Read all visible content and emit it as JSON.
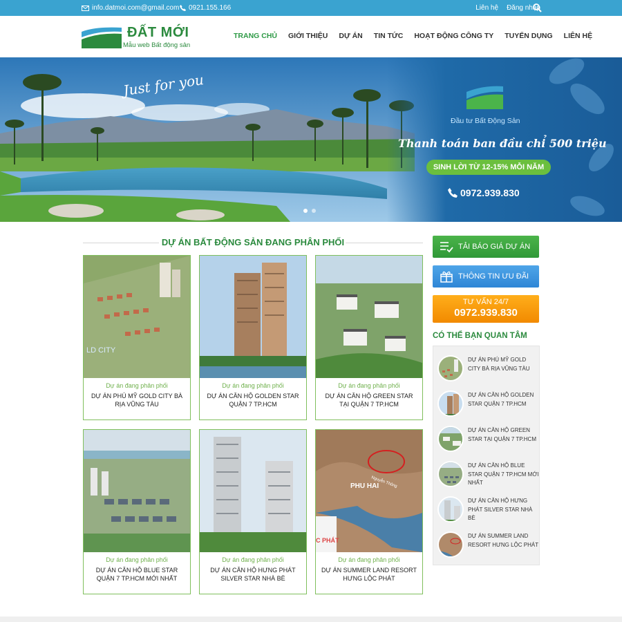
{
  "topbar": {
    "email": "info.datmoi.com@gmail.com",
    "phone": "0921.155.166",
    "links": [
      "Liên hệ",
      "Đăng nhập"
    ]
  },
  "logo": {
    "title": "ĐẤT MỚI",
    "subtitle": "Mẫu web Bất động sản"
  },
  "nav": [
    "TRANG CHỦ",
    "GIỚI THIỆU",
    "DỰ ÁN",
    "TIN TỨC",
    "HOẠT ĐỘNG CÔNG TY",
    "TUYỂN DỤNG",
    "LIÊN HỆ"
  ],
  "banner": {
    "script_text": "Just for you",
    "brand": "Đầu tư Bất Động Sản",
    "headline": "Thanh toán ban đầu chỉ 500 triệu",
    "pill": "SINH LỜI TỪ 12-15% MỖI NĂM",
    "phone": "0972.939.830",
    "thumb_caption": "LD CITY"
  },
  "section": {
    "title": "DỰ ÁN BẤT ĐỘNG SẢN ĐANG PHÂN PHỐI"
  },
  "projects": [
    {
      "category": "Dự án đang phân phối",
      "name": "DỰ ÁN PHÚ MỸ GOLD CITY BÀ RỊA VŨNG TÀU"
    },
    {
      "category": "Dự án đang phân phối",
      "name": "DỰ ÁN CĂN HỘ GOLDEN STAR QUẬN 7 Tp.HCM"
    },
    {
      "category": "Dự án đang phân phối",
      "name": "DỰ ÁN CĂN HỘ GREEN STAR TẠI QUẬN 7 TP.HCM"
    },
    {
      "category": "Dự án đang phân phối",
      "name": "DỰ ÁN CĂN HỘ BLUE STAR QUẬN 7 TP.HCM MỚI NHẤT"
    },
    {
      "category": "Dự án đang phân phối",
      "name": "DỰ ÁN CĂN HỘ HƯNG PHÁT SILVER STAR NHÀ BÈ"
    },
    {
      "category": "Dự án đang phân phối",
      "name": "DỰ ÁN SUMMER LAND RESORT HƯNG LỘC PHÁT"
    }
  ],
  "map_labels": {
    "area": "PHU HAI",
    "road": "Nguyễn Thông",
    "brand": "C PHÁT"
  },
  "sidebar": {
    "price_button": "TẢI BÁO GIÁ DỰ ÁN",
    "offer_button": "THÔNG TIN ƯU ĐÃI",
    "hotline_label": "TƯ VẤN 24/7",
    "hotline_number": "0972.939.830",
    "interest_title": "CÓ THỂ BẠN QUAN TÂM",
    "items": [
      "DỰ ÁN PHÚ MỸ GOLD CITY BÀ RỊA VŨNG TÀU",
      "DỰ ÁN CĂN HỘ GOLDEN STAR QUẬN 7 Tp.HCM",
      "DỰ ÁN CĂN HỘ GREEN STAR TẠI QUẬN 7 TP.HCM",
      "DỰ ÁN CĂN HỘ BLUE STAR QUẬN 7 TP.HCM MỚI NHẤT",
      "DỰ ÁN CĂN HỘ HƯNG PHÁT SILVER STAR NHÀ BÈ",
      "DỰ ÁN SUMMER LAND RESORT HƯNG LỘC PHÁT"
    ]
  },
  "colors": {
    "brand_green": "#2b8a3e",
    "topbar_blue": "#3aa3d0",
    "hotline_orange": "#f28a00"
  }
}
